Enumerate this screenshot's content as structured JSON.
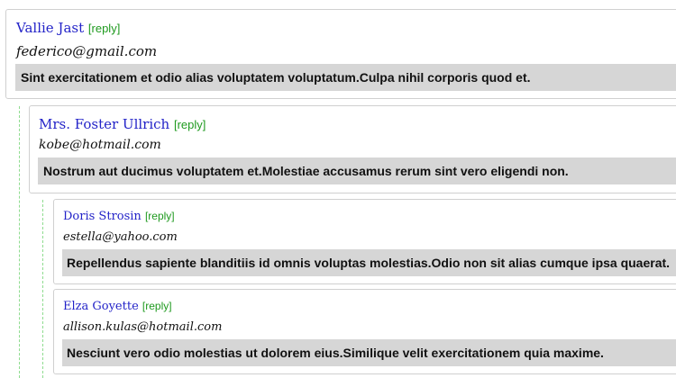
{
  "comments": [
    {
      "name": "Vallie Jast",
      "reply": "[reply]",
      "email": "federico@gmail.com",
      "body": "Sint exercitationem et odio alias voluptatem voluptatum.Culpa nihil corporis quod et."
    },
    {
      "name": "Mrs. Foster Ullrich",
      "reply": "[reply]",
      "email": "kobe@hotmail.com",
      "body": "Nostrum aut ducimus voluptatem et.Molestiae accusamus rerum sint vero eligendi non."
    },
    {
      "name": "Doris Strosin",
      "reply": "[reply]",
      "email": "estella@yahoo.com",
      "body": "Repellendus sapiente blanditiis id omnis voluptas molestias.Odio non sit alias cumque ipsa quaerat."
    },
    {
      "name": "Elza Goyette",
      "reply": "[reply]",
      "email": "allison.kulas@hotmail.com",
      "body": "Nesciunt vero odio molestias ut dolorem eius.Similique velit exercitationem quia maxime."
    }
  ]
}
